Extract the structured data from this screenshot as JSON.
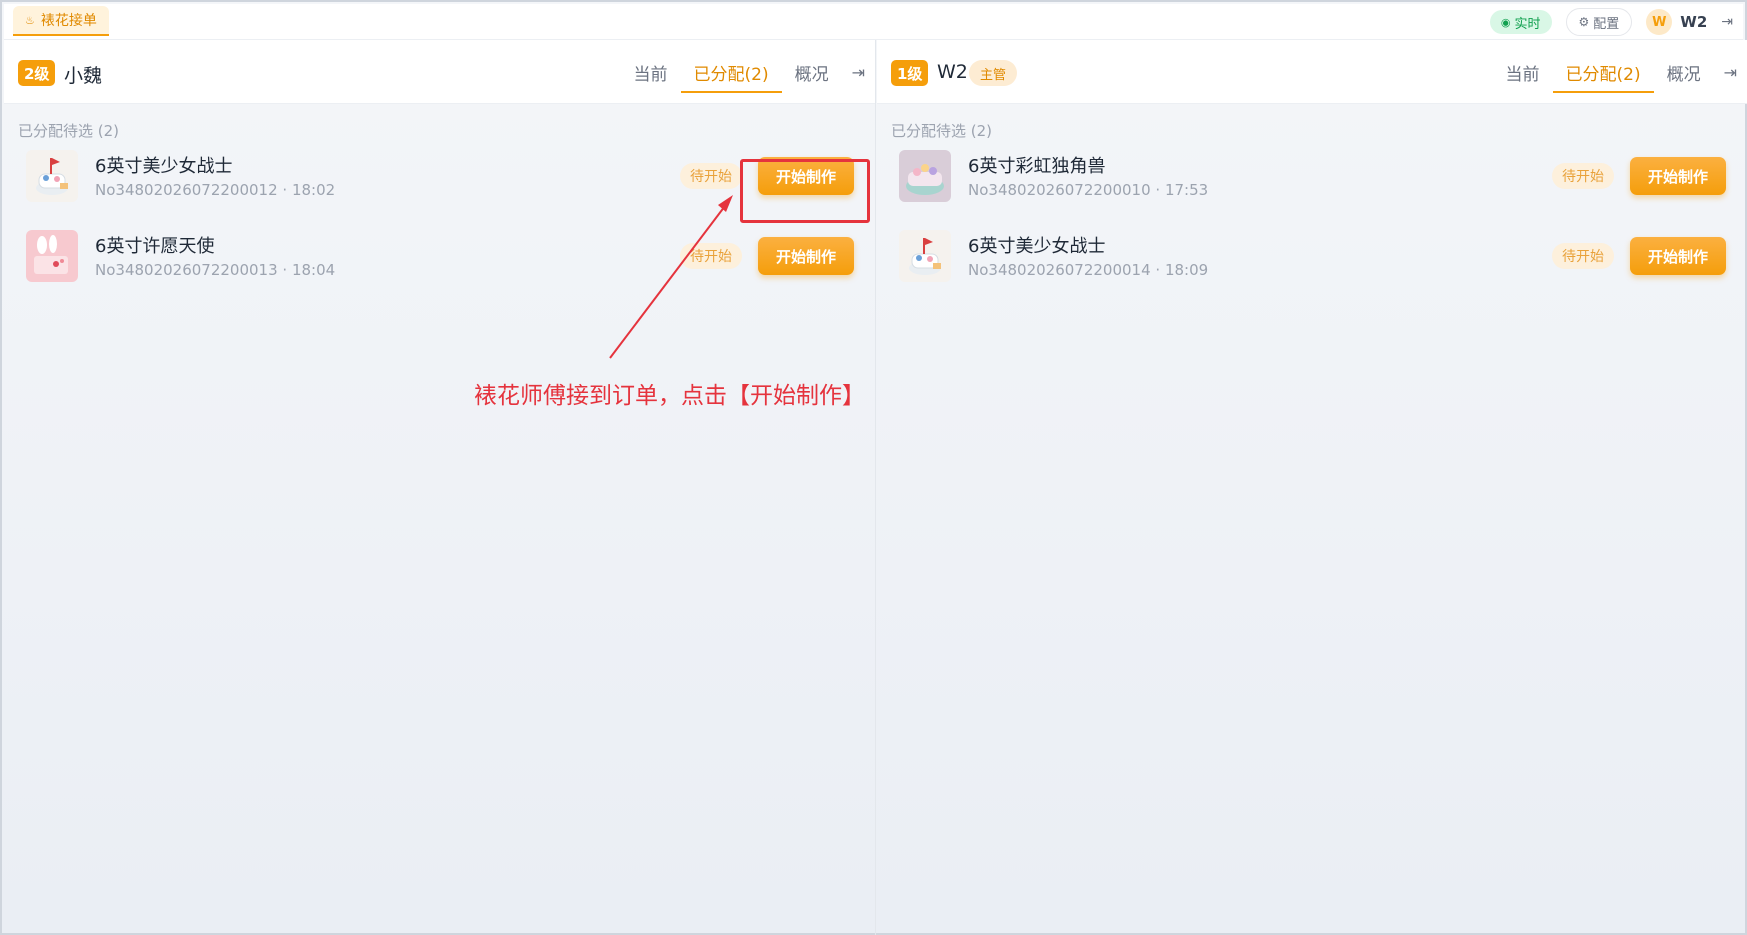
{
  "app": {
    "tab_icon": "cake-icon",
    "tab_label": "裱花接单",
    "live_label": "实时",
    "config_label": "配置",
    "user_initial": "W",
    "user_name": "W2"
  },
  "panels": [
    {
      "level": "2级",
      "name": "小魏",
      "role": "",
      "tabs": [
        "当前",
        "已分配(2)",
        "概况"
      ],
      "active_tab": 1,
      "section_title": "已分配待选 (2)",
      "orders": [
        {
          "title": "6英寸美少女战士",
          "meta": "No34802026072200012 · 18:02",
          "status": "待开始",
          "action": "开始制作",
          "thumb": "cake-sailor"
        },
        {
          "title": "6英寸许愿天使",
          "meta": "No34802026072200013 · 18:04",
          "status": "待开始",
          "action": "开始制作",
          "thumb": "cake-angel"
        }
      ]
    },
    {
      "level": "1级",
      "name": "W2",
      "role": "主管",
      "tabs": [
        "当前",
        "已分配(2)",
        "概况"
      ],
      "active_tab": 1,
      "section_title": "已分配待选 (2)",
      "orders": [
        {
          "title": "6英寸彩虹独角兽",
          "meta": "No34802026072200010 · 17:53",
          "status": "待开始",
          "action": "开始制作",
          "thumb": "cake-unicorn"
        },
        {
          "title": "6英寸美少女战士",
          "meta": "No34802026072200014 · 18:09",
          "status": "待开始",
          "action": "开始制作",
          "thumb": "cake-sailor"
        }
      ]
    }
  ],
  "annotation": {
    "text": "裱花师傅接到订单，点击【开始制作】",
    "color": "#e5333d"
  },
  "colors": {
    "accent": "#f59e0b",
    "live": "#12a150"
  }
}
